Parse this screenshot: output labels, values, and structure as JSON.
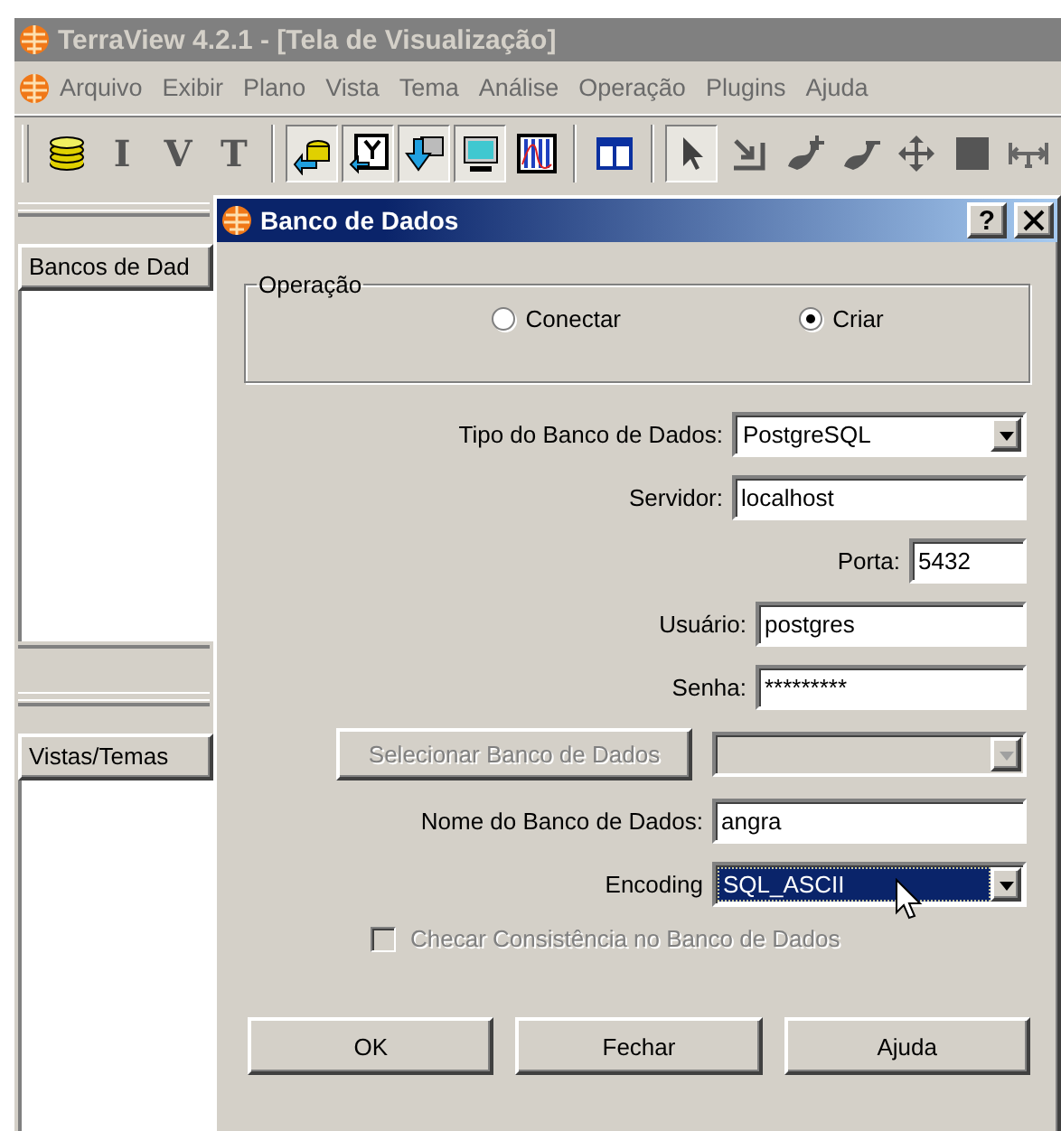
{
  "window": {
    "title": "TerraView 4.2.1 - [Tela de Visualização]"
  },
  "menu": [
    "Arquivo",
    "Exibir",
    "Plano",
    "Vista",
    "Tema",
    "Análise",
    "Operação",
    "Plugins",
    "Ajuda"
  ],
  "toolbar": [
    [
      {
        "kind": "database",
        "pressed": false
      },
      {
        "kind": "letter",
        "text": "I",
        "pressed": false
      },
      {
        "kind": "letter",
        "text": "V",
        "pressed": false
      },
      {
        "kind": "letter",
        "text": "T",
        "pressed": false
      }
    ],
    [
      {
        "kind": "import-database",
        "pressed": true
      },
      {
        "kind": "import-table",
        "pressed": true
      },
      {
        "kind": "import-down",
        "pressed": true
      },
      {
        "kind": "monitor",
        "pressed": true
      },
      {
        "kind": "chart",
        "pressed": false
      }
    ],
    [
      {
        "kind": "panel",
        "pressed": false
      }
    ],
    [
      {
        "kind": "pointer",
        "pressed": true
      },
      {
        "kind": "corner",
        "pressed": false
      },
      {
        "kind": "add-point",
        "pressed": false
      },
      {
        "kind": "remove-point",
        "pressed": false
      },
      {
        "kind": "move",
        "pressed": false
      },
      {
        "kind": "square",
        "pressed": false
      },
      {
        "kind": "measure",
        "pressed": false
      }
    ]
  ],
  "panels": [
    {
      "header": "Bancos de Dad"
    },
    {
      "header": "Vistas/Temas"
    }
  ],
  "dialog": {
    "title": "Banco de Dados",
    "help_button": "?",
    "operation": {
      "legend": "Operação",
      "options": [
        {
          "label": "Conectar",
          "selected": false
        },
        {
          "label": "Criar",
          "selected": true
        }
      ]
    },
    "fields": [
      {
        "kind": "select",
        "label": "Tipo do Banco de Dados:",
        "value": "PostgreSQL",
        "focused": false
      },
      {
        "kind": "text",
        "label": "Servidor:",
        "value": "localhost"
      },
      {
        "kind": "text",
        "label": "Porta:",
        "value": "5432"
      },
      {
        "kind": "text",
        "label": "Usuário:",
        "value": "postgres"
      },
      {
        "kind": "text",
        "label": "Senha:",
        "value": "*********"
      },
      {
        "kind": "picker",
        "button": "Selecionar Banco de Dados",
        "disabled": true
      },
      {
        "kind": "text",
        "label": "Nome do Banco de Dados:",
        "value": "angra"
      },
      {
        "kind": "select",
        "label": "Encoding",
        "value": "SQL_ASCII",
        "focused": true
      }
    ],
    "consistency_check": {
      "label": "Checar Consistência no Banco de Dados",
      "checked": false,
      "disabled": true
    },
    "buttons": [
      "OK",
      "Fechar",
      "Ajuda"
    ]
  }
}
